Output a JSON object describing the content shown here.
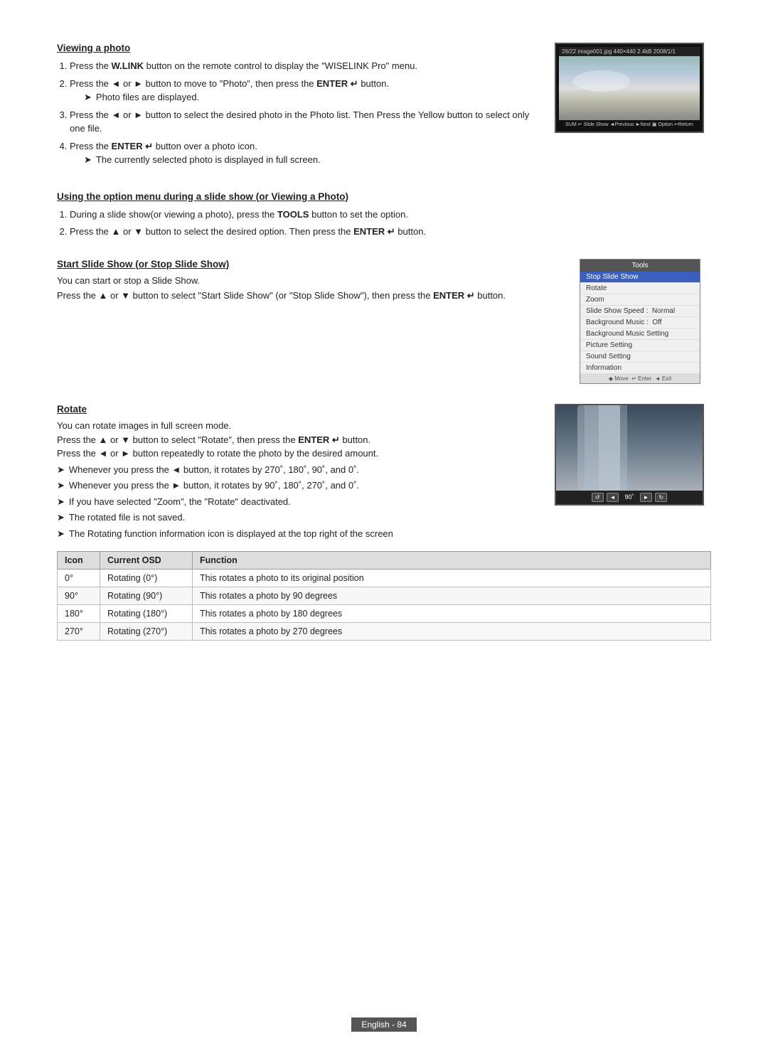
{
  "page": {
    "footer_label": "English - 84"
  },
  "viewing_photo": {
    "title": "Viewing a photo",
    "steps": [
      "Press the W.LINK button on the remote control to display the \"WISELINK Pro\" menu.",
      "Press the ◄ or ► button to move to \"Photo\", then press the ENTER ↵ button.",
      "Photo files are displayed.",
      "Press the ◄ or ► button to select the desired photo in the Photo list. Then Press the Yellow button to select only one file.",
      "Press the ENTER ↵ button over a photo icon.",
      "The currently selected photo is displayed in full screen."
    ]
  },
  "using_option_menu": {
    "title": "Using the option menu during a slide show (or Viewing a Photo)",
    "steps": [
      "During a slide show(or viewing a photo), press the TOOLS button to set the option.",
      "Press the ▲ or ▼ button to select the desired option. Then press the ENTER ↵ button."
    ]
  },
  "start_slide_show": {
    "title": "Start Slide Show (or Stop Slide Show)",
    "desc": "You can start or stop a Slide Show.",
    "instruction": "Press the ▲ or ▼ button to select \"Start Slide Show\" (or \"Stop Slide Show\"), then press the ENTER ↵ button.",
    "tools_menu": {
      "title": "Tools",
      "items": [
        {
          "label": "Stop Slide Show",
          "highlighted": true
        },
        {
          "label": "Rotate",
          "highlighted": false
        },
        {
          "label": "Zoom",
          "highlighted": false
        },
        {
          "label": "Slide Show Speed :  Normal",
          "highlighted": false
        },
        {
          "label": "Background Music :  Off",
          "highlighted": false
        },
        {
          "label": "Background Music Setting",
          "highlighted": false
        },
        {
          "label": "Picture Setting",
          "highlighted": false
        },
        {
          "label": "Sound Setting",
          "highlighted": false
        },
        {
          "label": "Information",
          "highlighted": false
        }
      ],
      "footer": "◆ Move  ↵ Enter  ◄ Exit"
    }
  },
  "rotate": {
    "title": "Rotate",
    "desc": "You can rotate images in full screen mode.",
    "instruction1": "Press the ▲ or ▼ button to select \"Rotate\", then press the ENTER ↵ button.",
    "instruction2": "Press the ◄ or ► button repeatedly to rotate the photo by the desired amount.",
    "bullets": [
      "Whenever you press the ◄ button, it rotates by 270˚, 180˚, 90˚, and 0˚.",
      "Whenever you press the ► button, it rotates by 90˚, 180˚, 270˚, and 0˚.",
      "If you have selected \"Zoom\", the \"Rotate\" deactivated.",
      "The rotated file is not saved.",
      "The Rotating function information icon is displayed at the top right of the screen"
    ],
    "controls": {
      "icon1": "↺",
      "label1": "◄",
      "label2": "90˚",
      "label3": "►",
      "icon2": "↻"
    },
    "table": {
      "headers": [
        "Icon",
        "Current OSD",
        "Function"
      ],
      "rows": [
        {
          "icon": "0°",
          "osd": "Rotating (0°)",
          "function": "This rotates a photo to its original position"
        },
        {
          "icon": "90°",
          "osd": "Rotating (90°)",
          "function": "This rotates a photo by 90 degrees"
        },
        {
          "icon": "180°",
          "osd": "Rotating (180°)",
          "function": "This rotates a photo by 180 degrees"
        },
        {
          "icon": "270°",
          "osd": "Rotating (270°)",
          "function": "This rotates a photo by 270 degrees"
        }
      ]
    }
  },
  "tv_screen": {
    "statusbar": "26/22  image001.jpg  440×440  2.4kB  2008/1/1",
    "bottombar": "SUM    ↵ Slide Show  ◄Previous  ►Next  ▣ Option  ↩Return"
  }
}
